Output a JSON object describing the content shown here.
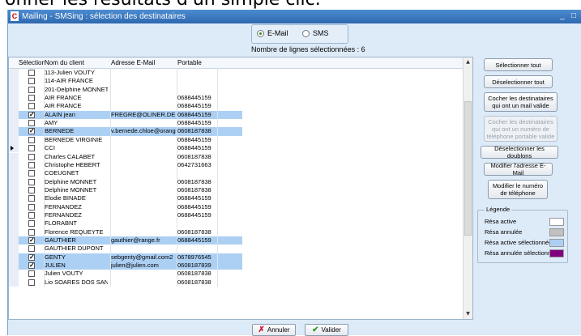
{
  "caption_text": "onner les résultats d'un simple clic.",
  "window": {
    "title": "Mailing - SMSing : sélection des destinataires",
    "app_icon": "C",
    "minimize": "_",
    "maximize": "□"
  },
  "mode": {
    "email_label": "E-Mail",
    "sms_label": "SMS",
    "selected": "E-Mail"
  },
  "selected_count_label": "Nombre de lignes sélectionnées : 6",
  "table": {
    "columns": [
      "Sélection",
      "Nom du client",
      "Adresse E-Mail",
      "Portable"
    ],
    "rows": [
      {
        "checked": false,
        "name": "113-Julien VOUTY",
        "email": "",
        "phone": ""
      },
      {
        "checked": false,
        "name": "114-AIR FRANCE",
        "email": "",
        "phone": ""
      },
      {
        "checked": false,
        "name": "201-Delphine MONNET",
        "email": "",
        "phone": ""
      },
      {
        "checked": false,
        "name": "AIR FRANCE",
        "email": "",
        "phone": "0688445159"
      },
      {
        "checked": false,
        "name": "AIR FRANCE",
        "email": "",
        "phone": "0688445159"
      },
      {
        "checked": true,
        "name": "ALAIN jean",
        "email": "FREGRE@OLINER.DE",
        "phone": "0688445159"
      },
      {
        "checked": false,
        "name": "AMY",
        "email": "",
        "phone": "0688445159"
      },
      {
        "checked": true,
        "name": "BERNEDE",
        "email": "v.bernede.chloe@orange",
        "phone": "0608187838"
      },
      {
        "checked": false,
        "name": "BERNEDE VIRGINIE",
        "email": "",
        "phone": "0688445159"
      },
      {
        "checked": false,
        "name": "CCI",
        "email": "",
        "phone": "0688445159"
      },
      {
        "checked": false,
        "name": "Charles CALABET",
        "email": "",
        "phone": "0608187838"
      },
      {
        "checked": false,
        "name": "Christophe HEBERT",
        "email": "",
        "phone": "0642731663"
      },
      {
        "checked": false,
        "name": "COEUGNET",
        "email": "",
        "phone": ""
      },
      {
        "checked": false,
        "name": "Delphine MONNET",
        "email": "",
        "phone": "0608187838"
      },
      {
        "checked": false,
        "name": "Delphine MONNET",
        "email": "",
        "phone": "0608187838"
      },
      {
        "checked": false,
        "name": "Elodie BINADE",
        "email": "",
        "phone": "0688445159"
      },
      {
        "checked": false,
        "name": "FERNANDEZ",
        "email": "",
        "phone": "0688445159"
      },
      {
        "checked": false,
        "name": "FERNANDEZ",
        "email": "",
        "phone": "0688445159"
      },
      {
        "checked": false,
        "name": "FLORABNT",
        "email": "",
        "phone": ""
      },
      {
        "checked": false,
        "name": "Florence REQUEYTE",
        "email": "",
        "phone": "0608187838"
      },
      {
        "checked": true,
        "name": "GAUTHIER",
        "email": "gauthier@range.fr",
        "phone": "0688445159"
      },
      {
        "checked": false,
        "name": "GAUTHIER DUPONT",
        "email": "",
        "phone": ""
      },
      {
        "checked": true,
        "name": "GENTY",
        "email": "sebgenty@gmail.com2",
        "phone": "0678976545"
      },
      {
        "checked": true,
        "name": "JULIEN",
        "email": "julien@julien.com",
        "phone": "0608187839"
      },
      {
        "checked": false,
        "name": "Julien VOUTY",
        "email": "",
        "phone": "0608187838"
      },
      {
        "checked": false,
        "name": "Lio SOARES DOS SANTO",
        "email": "",
        "phone": "0608187838"
      }
    ],
    "current_row": 9
  },
  "side_buttons": [
    {
      "label": "Sélectionner tout",
      "enabled": true
    },
    {
      "label": "Déselectionner tout",
      "enabled": true
    },
    {
      "label": "Cocher les destinataires qui ont un mail valide",
      "enabled": true
    },
    {
      "label": "Cocher les destinataires qui ont un numéro de téléphone portable valide",
      "enabled": false
    },
    {
      "label": "Déselectionner les doublons",
      "enabled": true
    },
    {
      "label": "Modifier l'adresse E-Mail",
      "enabled": true
    },
    {
      "label": "Modifier le numéro de téléphone",
      "enabled": true
    }
  ],
  "legend": {
    "title": "Légende",
    "items": [
      {
        "label": "Résa active",
        "color": "#ffffff"
      },
      {
        "label": "Résa annulée",
        "color": "#c0c0c0"
      },
      {
        "label": "Résa active sélectionnée",
        "color": "#acd0f4"
      },
      {
        "label": "Résa annulée sélectionnée",
        "color": "#800080"
      }
    ]
  },
  "footer": {
    "cancel_label": "Annuler",
    "validate_label": "Valider"
  },
  "colors": {
    "selected_row": "#acd0f4",
    "window_bg": "#ddeaf7",
    "titlebar": "#2d68b0"
  }
}
